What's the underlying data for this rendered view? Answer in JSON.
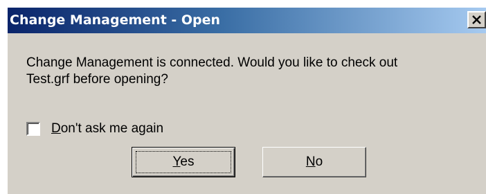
{
  "dialog": {
    "title": "Change Management - Open",
    "close_icon": "close-icon",
    "message_line1": "Change Management is connected. Would you like to check out",
    "message_line2": "Test.grf before opening?",
    "checkbox": {
      "mnemonic": "D",
      "label_rest": "on't ask me again",
      "checked": false
    },
    "buttons": {
      "yes": {
        "mnemonic": "Y",
        "rest": "es"
      },
      "no": {
        "mnemonic": "N",
        "rest": "o"
      }
    }
  },
  "colors": {
    "face": "#d4d0c8",
    "title_gradient_start": "#0a246a",
    "title_gradient_end": "#a6caf0",
    "title_text": "#ffffff"
  }
}
